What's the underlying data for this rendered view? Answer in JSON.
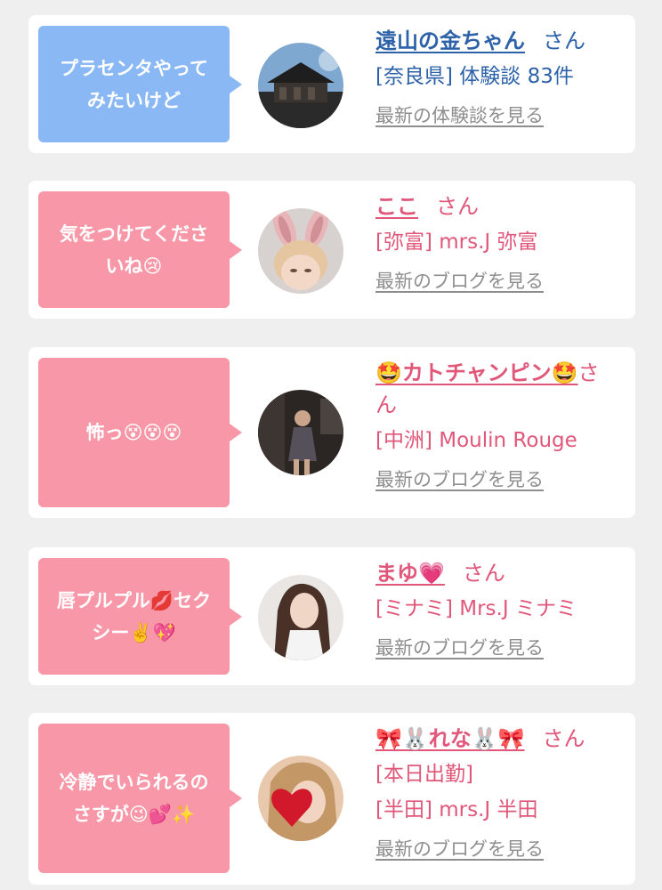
{
  "posts": [
    {
      "bubble": "プラセンタやって\nみたいけど",
      "name": "遠山の金ちゃん",
      "san": "さん",
      "details": [
        "[奈良県] 体験談 83件"
      ],
      "more": "最新の体験談を見る",
      "avatar_icon": "temple-photo"
    },
    {
      "bubble": "気をつけてくださ\nいね😢",
      "name": "ここ",
      "san": "さん",
      "details": [
        "[弥富] mrs.J 弥富"
      ],
      "more": "最新のブログを見る",
      "avatar_icon": "bunny-ears-photo"
    },
    {
      "bubble": "怖っ😵😵😵",
      "name": "🤩カトチャンピン🤩",
      "san": "さん",
      "details": [
        "[中洲] Moulin Rouge"
      ],
      "more": "最新のブログを見る",
      "avatar_icon": "woman-dark-photo"
    },
    {
      "bubble": "唇プルプル💋セク\nシー✌️💖",
      "name": "まゆ💗",
      "san": "さん",
      "details": [
        "[ミナミ] Mrs.J ミナミ"
      ],
      "more": "最新のブログを見る",
      "avatar_icon": "woman-long-hair-photo"
    },
    {
      "bubble": "冷静でいられるの\nさすが😉💕✨",
      "name": "🎀🐰れな🐰🎀",
      "san": "さん",
      "details": [
        "[本日出勤]",
        "[半田] mrs.J 半田"
      ],
      "more": "最新のブログを見る",
      "avatar_icon": "heart-face-photo"
    }
  ],
  "colors": {
    "bubble_blue": "#8ab8f5",
    "bubble_pink": "#f797a7",
    "text_blue": "#2d62a8",
    "text_pink": "#e1577a",
    "link_gray": "#8e8e8e"
  }
}
